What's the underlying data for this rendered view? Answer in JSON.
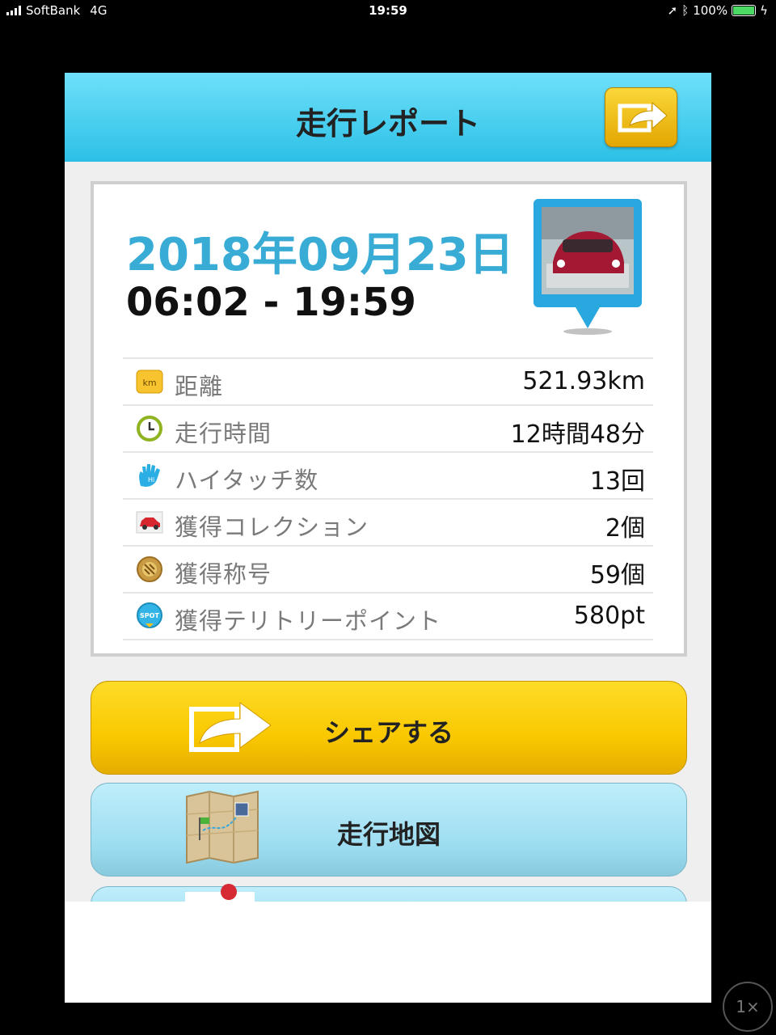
{
  "status_bar": {
    "carrier": "SoftBank",
    "network": "4G",
    "time": "19:59",
    "battery": "100%"
  },
  "header": {
    "title": "走行レポート",
    "share_icon": "share-arrow-icon"
  },
  "report": {
    "date": "2018年09月23日",
    "time_range": "06:02 - 19:59",
    "rows": [
      {
        "icon": "km-icon",
        "label": "距離",
        "value": "521.93km"
      },
      {
        "icon": "clock-icon",
        "label": "走行時間",
        "value": "12時間48分"
      },
      {
        "icon": "hand-icon",
        "label": "ハイタッチ数",
        "value": "13回"
      },
      {
        "icon": "car-icon",
        "label": "獲得コレクション",
        "value": "2個"
      },
      {
        "icon": "medal-icon",
        "label": "獲得称号",
        "value": "59個"
      },
      {
        "icon": "spot-icon",
        "label": "獲得テリトリーポイント",
        "value": "580pt"
      }
    ]
  },
  "buttons": {
    "share": "シェアする",
    "map": "走行地図"
  },
  "zoom": "1×",
  "colors": {
    "accent": "#39acd6",
    "header": "#2cc0e6",
    "share_button": "#f9c800",
    "map_button": "#9cdcf0"
  }
}
